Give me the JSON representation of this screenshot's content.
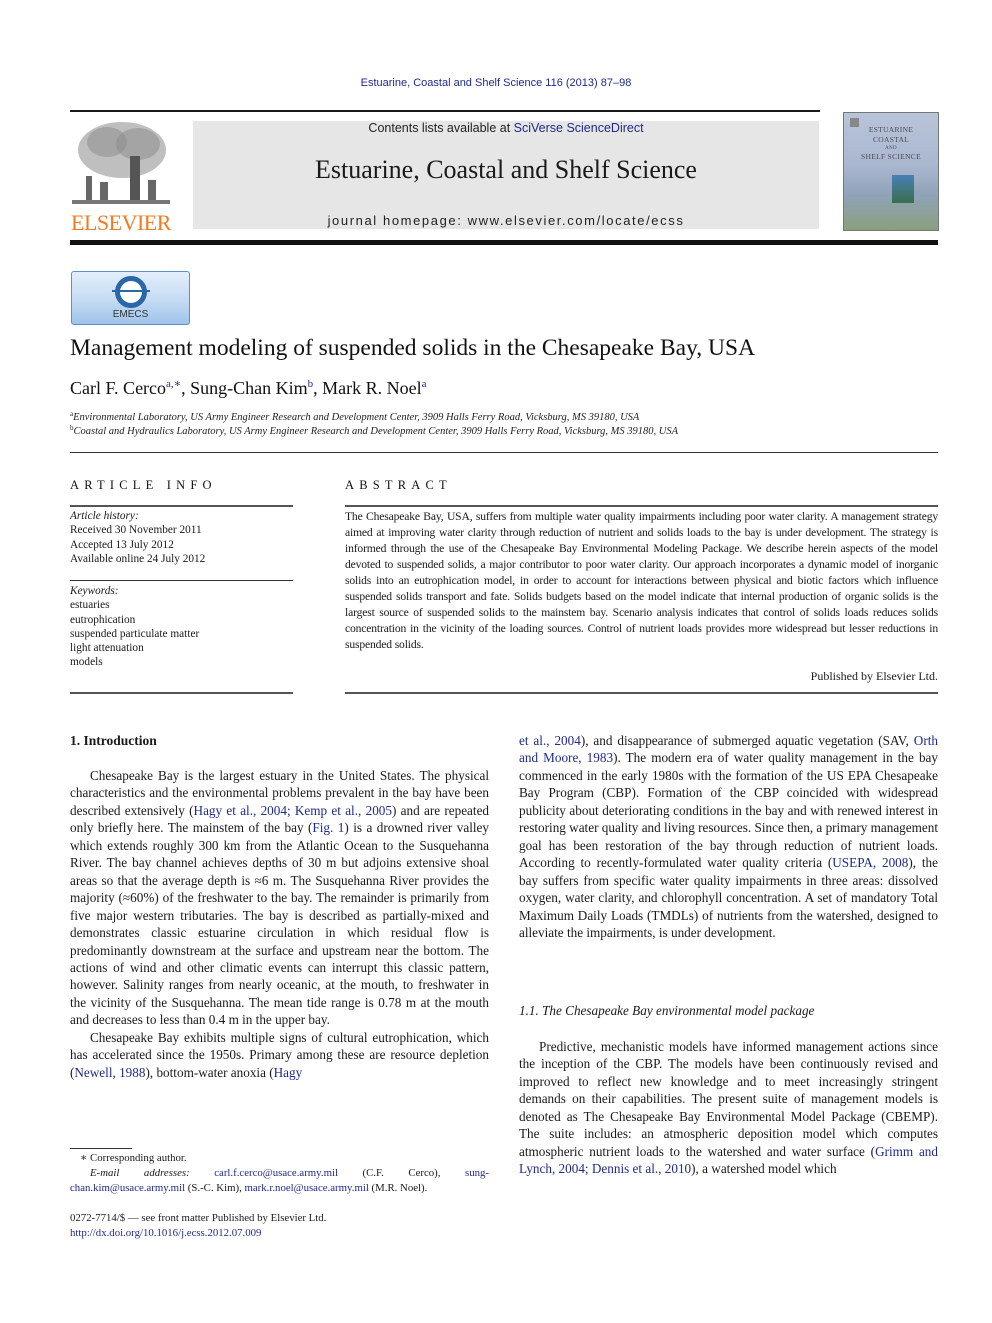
{
  "citation": "Estuarine, Coastal and Shelf Science 116 (2013) 87–98",
  "masthead": {
    "contents_prefix": "Contents lists available at ",
    "contents_link": "SciVerse ScienceDirect",
    "journal_title": "Estuarine, Coastal and Shelf Science",
    "homepage": "journal homepage: www.elsevier.com/locate/ecss",
    "publisher_logo_text": "ELSEVIER",
    "cover_title_lines": [
      "ESTUARINE",
      "COASTAL",
      "AND",
      "SHELF SCIENCE"
    ]
  },
  "badge": {
    "label": "EMECS"
  },
  "article": {
    "title": "Management modeling of suspended solids in the Chesapeake Bay, USA",
    "authors": [
      {
        "name": "Carl F. Cerco",
        "sup": "a,∗",
        "sep": ", "
      },
      {
        "name": "Sung-Chan Kim",
        "sup": "b",
        "sep": ", "
      },
      {
        "name": "Mark R. Noel",
        "sup": "a",
        "sep": ""
      }
    ],
    "affiliations": [
      {
        "mark": "a",
        "text": "Environmental Laboratory, US Army Engineer Research and Development Center, 3909 Halls Ferry Road, Vicksburg, MS 39180, USA"
      },
      {
        "mark": "b",
        "text": "Coastal and Hydraulics Laboratory, US Army Engineer Research and Development Center, 3909 Halls Ferry Road, Vicksburg, MS 39180, USA"
      }
    ]
  },
  "article_info": {
    "heading": "ARTICLE INFO",
    "history_label": "Article history:",
    "history": [
      "Received 30 November 2011",
      "Accepted 13 July 2012",
      "Available online 24 July 2012"
    ],
    "keywords_label": "Keywords:",
    "keywords": [
      "estuaries",
      "eutrophication",
      "suspended particulate matter",
      "light attenuation",
      "models"
    ]
  },
  "abstract": {
    "heading": "ABSTRACT",
    "text": "The Chesapeake Bay, USA, suffers from multiple water quality impairments including poor water clarity. A management strategy aimed at improving water clarity through reduction of nutrient and solids loads to the bay is under development. The strategy is informed through the use of the Chesapeake Bay Environmental Modeling Package. We describe herein aspects of the model devoted to suspended solids, a major contributor to poor water clarity. Our approach incorporates a dynamic model of inorganic solids into an eutrophication model, in order to account for interactions between physical and biotic factors which influence suspended solids transport and fate. Solids budgets based on the model indicate that internal production of organic solids is the largest source of suspended solids to the mainstem bay. Scenario analysis indicates that control of solids loads reduces solids concentration in the vicinity of the loading sources. Control of nutrient loads provides more widespread but lesser reductions in suspended solids.",
    "publisher_note": "Published by Elsevier Ltd."
  },
  "body": {
    "intro_heading": "1.  Introduction",
    "p1": [
      {
        "t": "Chesapeake Bay is the largest estuary in the United States. The physical characteristics and the environmental problems prevalent in the bay have been described extensively ("
      },
      {
        "link": "Hagy et al., 2004; Kemp et al., 2005"
      },
      {
        "t": ") and are repeated only briefly here. The mainstem of the bay ("
      },
      {
        "link": "Fig. 1"
      },
      {
        "t": ") is a drowned river valley which extends roughly 300 km from the Atlantic Ocean to the Susquehanna River. The bay channel achieves depths of 30 m but adjoins extensive shoal areas so that the average depth is ≈6 m. The Susquehanna River provides the majority (≈60%) of the freshwater to the bay. The remainder is primarily from five major western tributaries. The bay is described as partially-mixed and demonstrates classic estuarine circulation in which residual flow is predominantly downstream at the surface and upstream near the bottom. The actions of wind and other climatic events can interrupt this classic pattern, however. Salinity ranges from nearly oceanic, at the mouth, to freshwater in the vicinity of the Susquehanna. The mean tide range is 0.78 m at the mouth and decreases to less than 0.4 m in the upper bay."
      }
    ],
    "p2": [
      {
        "t": "Chesapeake Bay exhibits multiple signs of cultural eutrophica­tion, which has accelerated since the 1950s. Primary among these are resource depletion ("
      },
      {
        "link": "Newell, 1988"
      },
      {
        "t": "), bottom-water anoxia ("
      },
      {
        "link": "Hagy"
      }
    ],
    "p2_cont": [
      {
        "link": "et al., 2004"
      },
      {
        "t": "), and disappearance of submerged aquatic vegetation (SAV, "
      },
      {
        "link": "Orth and Moore, 1983"
      },
      {
        "t": "). The modern era of water quality management in the bay commenced in the early 1980s with the formation of the US EPA Chesapeake Bay Program (CBP). Formation of the CBP coincided with widespread publicity about deteriorating conditions in the bay and with renewed interest in restoring water quality and living resources. Since then, a primary management goal has been restoration of the bay through reduction of nutrient loads. According to recently-formulated water quality criteria ("
      },
      {
        "link": "USEPA, 2008"
      },
      {
        "t": "), the bay suffers from specific water quality impair­ments in three areas: dissolved oxygen, water clarity, and chloro­phyll concentration. A set of mandatory Total Maximum Daily Loads (TMDLs) of nutrients from the watershed, designed to alle­viate the impairments, is under development."
      }
    ],
    "subsection_heading": "1.1.  The Chesapeake Bay environmental model package",
    "p3": [
      {
        "t": "Predictive, mechanistic models have informed management actions since the inception of the CBP. The models have been continuously revised and improved to reflect new knowledge and to meet increasingly stringent demands on their capabilities. The present suite of management models is denoted as The Chesapeake Bay Environmental Model Package (CBEMP). The suite includes: an atmospheric deposition model which computes atmospheric nutrient loads to the watershed and water surface ("
      },
      {
        "link": "Grimm and Lynch, 2004; Dennis et al., 2010"
      },
      {
        "t": "), a watershed model which"
      }
    ]
  },
  "footnotes": {
    "corresponding": "∗ Corresponding author.",
    "email_label": "E-mail addresses:",
    "emails": [
      {
        "addr": "carl.f.cerco@usace.army.mil",
        "who": " (C.F. Cerco), "
      },
      {
        "addr": "sung-chan.kim@usace.army.mil",
        "who": " (S.-C. Kim), "
      },
      {
        "addr": "mark.r.noel@usace.army.mil",
        "who": " (M.R. Noel)."
      }
    ],
    "issn": "0272-7714/$ — see front matter Published by Elsevier Ltd.",
    "doi": "http://dx.doi.org/10.1016/j.ecss.2012.07.009"
  },
  "colors": {
    "link": "#1f2a8c",
    "elsevier_orange": "#f07a22",
    "masthead_bg": "#e6e6e6"
  }
}
